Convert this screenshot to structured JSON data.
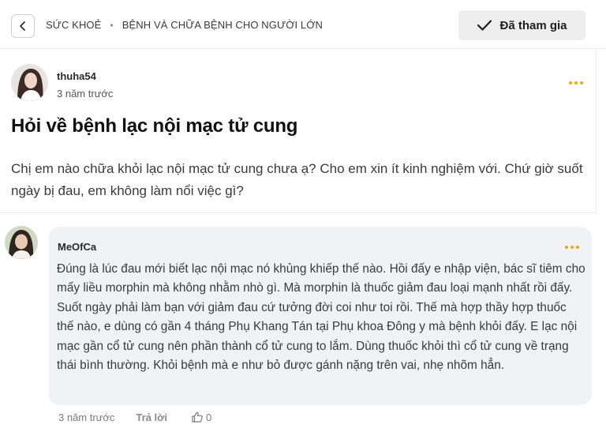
{
  "header": {
    "breadcrumb": [
      "SỨC KHOẺ",
      "BỆNH VÀ CHỮA BỆNH CHO NGƯỜI LỚN"
    ],
    "joined_label": "Đã tham gia"
  },
  "post": {
    "author": "thuha54",
    "time": "3 năm trước",
    "title": "Hỏi về bệnh lạc nội mạc tử cung",
    "body": "Chị em nào chữa khỏi lạc nội mạc tử cung chưa ạ? Cho em xin ít kinh nghiệm với. Chứ giờ suốt ngày bị đau, em không làm nổi việc gì?"
  },
  "comment": {
    "author": "MeOfCa",
    "body": "Đúng là lúc đau mới biết lạc nội mạc nó khủng khiếp thế nào. Hồi đấy e nhập viện, bác sĩ tiêm cho mấy liều morphin mà không nhằm nhò gì. Mà morphin là thuốc giảm đau loại mạnh nhất rồi đấy. Suốt ngày phải làm bạn với giảm đau cứ tưởng đời coi như toi rồi. Thế mà hợp thầy hợp thuốc thế nào, e dùng có gần 4 tháng Phụ Khang Tán tại Phụ khoa Đông y mà bệnh khỏi đấy. E lạc nội mạc gần cổ tử cung nên phần thành cổ tử cung to lắm. Dùng thuốc khỏi thì cổ tử cung về trạng thái bình thường. Khỏi bệnh mà e như bỏ được gánh nặng trên vai, nhẹ nhõm hẳn.",
    "time": "3 năm trước",
    "reply_label": "Trả lời",
    "like_count": "0"
  },
  "colors": {
    "accent_dots": "#f2a21f",
    "bubble_bg": "#f0f2f5",
    "joined_bg": "#eeeeee"
  }
}
